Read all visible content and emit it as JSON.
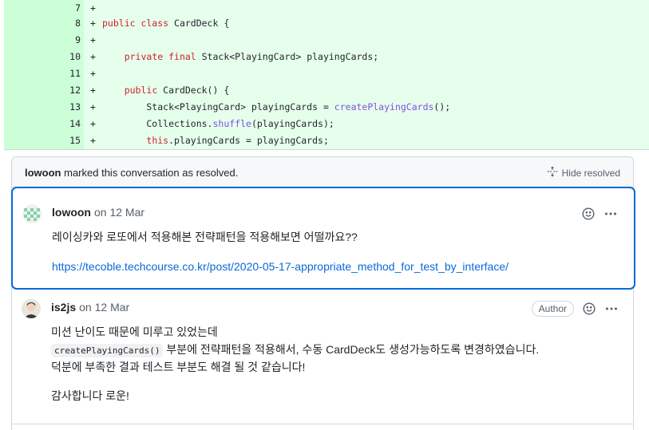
{
  "diff": {
    "lines": [
      {
        "num": "7",
        "sign": "+",
        "code": ""
      },
      {
        "num": "8",
        "sign": "+",
        "code": "public class CardDeck {"
      },
      {
        "num": "9",
        "sign": "+",
        "code": ""
      },
      {
        "num": "10",
        "sign": "+",
        "code": "    private final Stack<PlayingCard> playingCards;"
      },
      {
        "num": "11",
        "sign": "+",
        "code": ""
      },
      {
        "num": "12",
        "sign": "+",
        "code": "    public CardDeck() {"
      },
      {
        "num": "13",
        "sign": "+",
        "code": "        Stack<PlayingCard> playingCards = createPlayingCards();"
      },
      {
        "num": "14",
        "sign": "+",
        "code": "        Collections.shuffle(playingCards);"
      },
      {
        "num": "15",
        "sign": "+",
        "code": "        this.playingCards = playingCards;"
      }
    ]
  },
  "thread": {
    "resolved_user": "lowoon",
    "resolved_text": "marked this conversation as resolved.",
    "hide_resolved_label": "Hide resolved",
    "comments": [
      {
        "author": "lowoon",
        "date": "on 12 Mar",
        "body_line1": "레이싱카와 로또에서 적용해본 전략패턴을 적용해보면 어떨까요??",
        "link": "https://tecoble.techcourse.co.kr/post/2020-05-17-appropriate_method_for_test_by_interface/"
      },
      {
        "author": "is2js",
        "date": "on 12 Mar",
        "badge": "Author",
        "line1": "미션 난이도 때문에 미루고 있었는데",
        "code_ref": "createPlayingCards()",
        "line2_rest": " 부분에 전략패턴을 적용해서, 수동 CardDeck도 생성가능하도록 변경하였습니다.",
        "line3": "덕분에 부족한 결과 테스트 부분도 해결 될 것 같습니다!",
        "line4": "감사합니다 로운!"
      }
    ]
  },
  "colors": {
    "diff_bg": "#e6ffec",
    "gutter_bg": "#ccffd8",
    "keyword": "#cf222e",
    "function": "#8250df",
    "link": "#0969da",
    "focus_border": "#0969da"
  }
}
